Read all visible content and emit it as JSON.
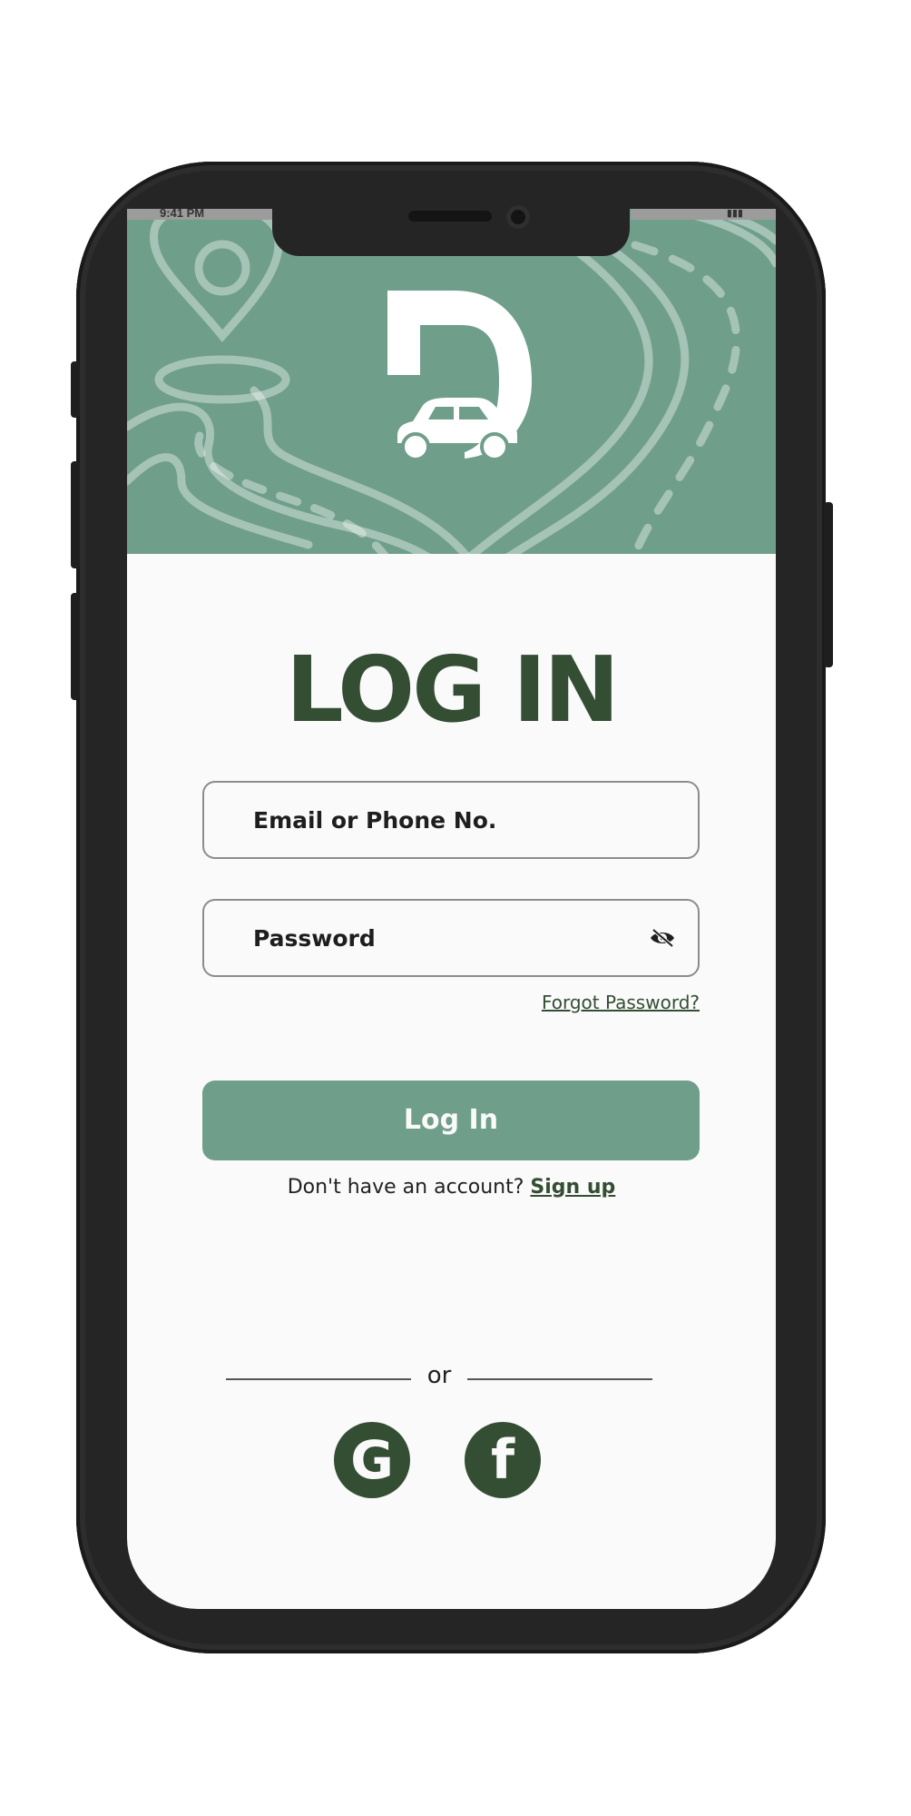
{
  "status_bar": {
    "time": "9:41 PM",
    "icons": "▮▮▮"
  },
  "header": {
    "logo_letter": "D"
  },
  "title": "LOG IN",
  "form": {
    "email_placeholder": "Email or Phone No.",
    "password_placeholder": "Password",
    "forgot_label": "Forgot Password?",
    "login_label": "Log In"
  },
  "signup": {
    "prompt": "Don't have an account?",
    "link": "Sign up"
  },
  "divider_label": "or",
  "social": {
    "google_glyph": "G",
    "facebook_glyph": "f"
  },
  "colors": {
    "primary_green": "#6f9e8b",
    "dark_green": "#344e33",
    "background": "#fafafa",
    "phone_frame": "#252525"
  }
}
